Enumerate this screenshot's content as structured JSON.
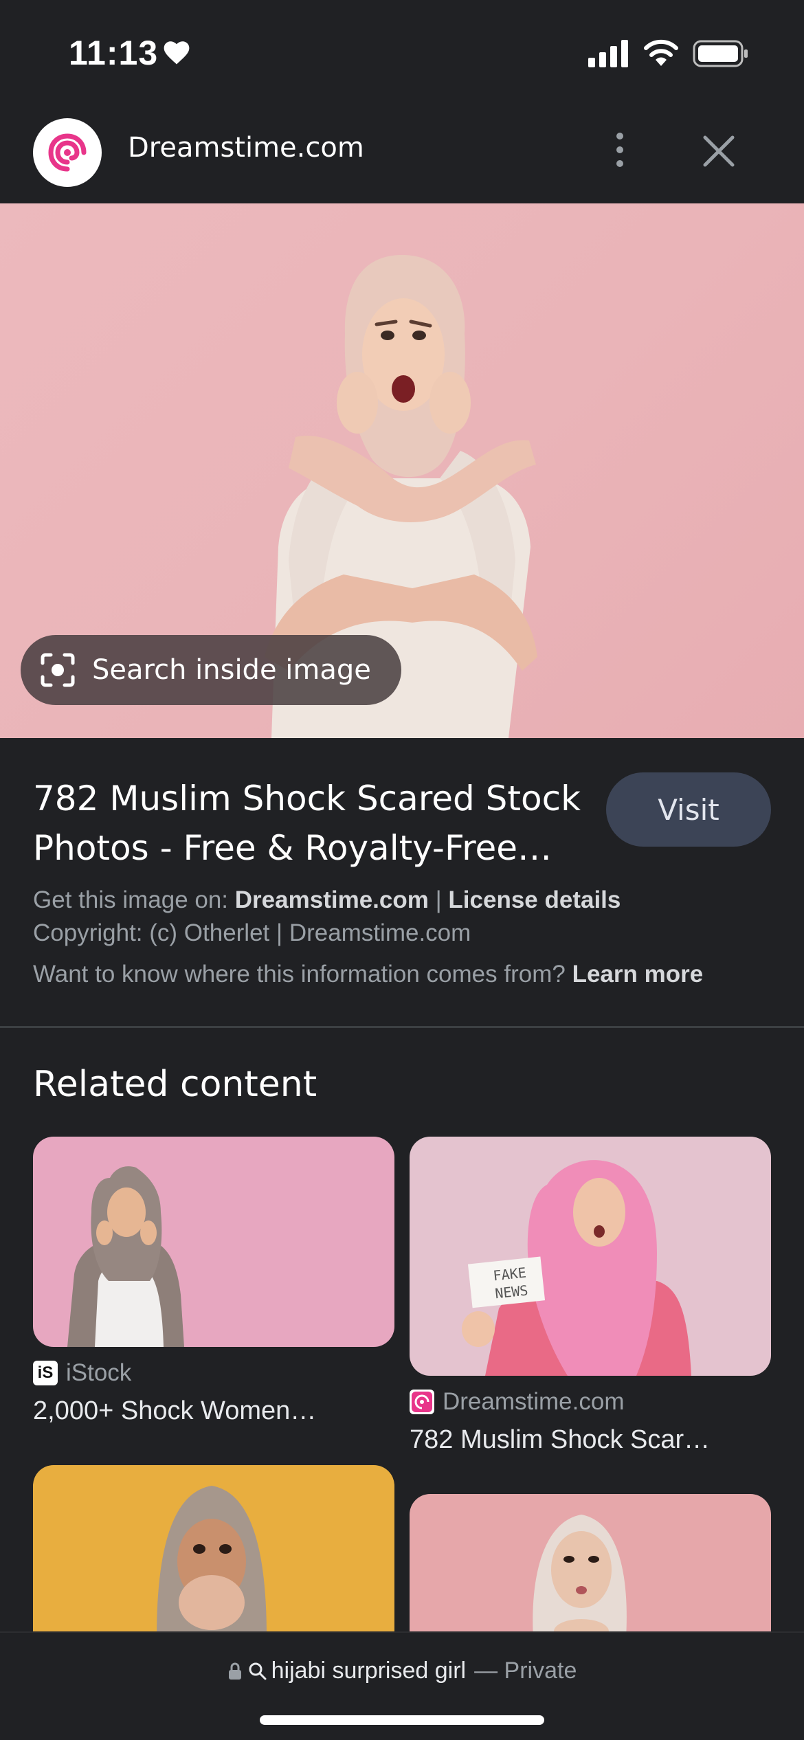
{
  "status_bar": {
    "time": "11:13"
  },
  "header": {
    "site_name": "Dreamstime.com",
    "brand_color": "#e8358a"
  },
  "hero": {
    "search_inside_label": "Search inside image"
  },
  "info": {
    "title": "782 Muslim Shock Scared Stock Photos - Free & Royalty-Free…",
    "visit_label": "Visit",
    "get_image_prefix": "Get this image on:",
    "get_image_source": "Dreamstime.com",
    "separator": "|",
    "license_link": "License details",
    "copyright": "Copyright: (c) Otherlet | Dreamstime.com",
    "info_question": "Want to know where this information comes from?",
    "learn_more": "Learn more"
  },
  "related": {
    "heading": "Related content",
    "items": [
      {
        "source": "iStock",
        "title": "2,000+ Shock Women…",
        "icon": "istock-icon"
      },
      {
        "source": "Dreamstime.com",
        "title": "782 Muslim Shock Scar…",
        "icon": "dreamstime-icon",
        "sign_text_1": "FAKE",
        "sign_text_2": "NEWS"
      },
      {
        "source": "",
        "title": ""
      },
      {
        "source": "",
        "title": ""
      }
    ]
  },
  "bottom_bar": {
    "query": "hijabi surprised girl",
    "mode": "— Private"
  }
}
